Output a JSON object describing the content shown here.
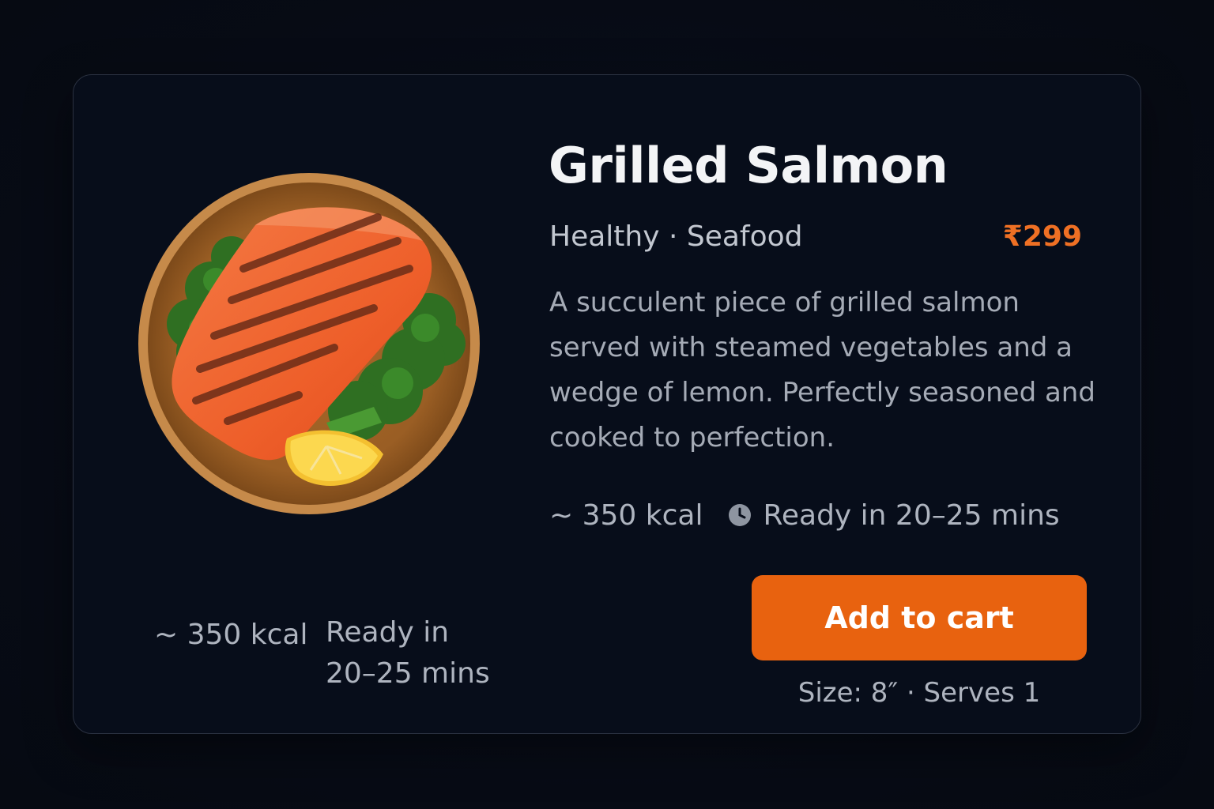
{
  "product": {
    "title": "Grilled Salmon",
    "tags": "Healthy · Seafood",
    "price": "₹299",
    "description": "A succulent piece of grilled salmon served with steamed vegetables and a wedge of lemon. Perfectly seasoned and cooked to perfection.",
    "image_icon": "grilled-salmon-plate"
  },
  "meta": {
    "calories": "~ 350 kcal",
    "ready_time": "Ready in 20–25 mins",
    "clock_icon": "clock-icon"
  },
  "left_meta": {
    "calories": "~ 350 kcal",
    "ready_time": "Ready in 20–25 mins"
  },
  "actions": {
    "add_to_cart_label": "Add to cart"
  },
  "footer": {
    "size_serves": "Size: 8″ · Serves 1"
  },
  "colors": {
    "accent": "#e8620f",
    "price": "#ef7024",
    "card_bg": "#070d1a",
    "page_bg": "#070b15"
  }
}
